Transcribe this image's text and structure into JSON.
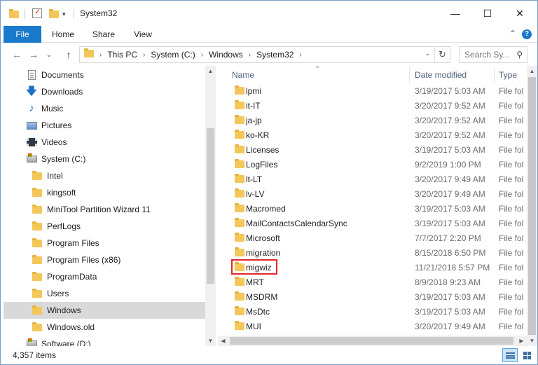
{
  "window": {
    "title": "System32",
    "minimize_glyph": "—",
    "maximize_glyph": "☐",
    "close_glyph": "✕"
  },
  "ribbon": {
    "tabs": [
      "File",
      "Home",
      "Share",
      "View"
    ],
    "help_glyph": "?",
    "collapse_glyph": "⌃"
  },
  "nav": {
    "back_glyph": "←",
    "forward_glyph": "→",
    "recent_glyph": "⌄",
    "up_glyph": "↑"
  },
  "address": {
    "crumbs": [
      "This PC",
      "System (C:)",
      "Windows",
      "System32"
    ],
    "separator": "›",
    "dropdown_glyph": "⌄",
    "refresh_glyph": "↻"
  },
  "search": {
    "placeholder": "Search Sy...",
    "icon_glyph": "⚲"
  },
  "tree": {
    "items": [
      {
        "label": "Documents",
        "icon": "documents-icon"
      },
      {
        "label": "Downloads",
        "icon": "downloads-icon"
      },
      {
        "label": "Music",
        "icon": "music-icon"
      },
      {
        "label": "Pictures",
        "icon": "pictures-icon"
      },
      {
        "label": "Videos",
        "icon": "videos-icon"
      },
      {
        "label": "System (C:)",
        "icon": "drive-icon"
      },
      {
        "label": "Intel",
        "icon": "folder-icon"
      },
      {
        "label": "kingsoft",
        "icon": "folder-icon"
      },
      {
        "label": "MiniTool Partition Wizard 11",
        "icon": "folder-icon"
      },
      {
        "label": "PerfLogs",
        "icon": "folder-icon"
      },
      {
        "label": "Program Files",
        "icon": "folder-icon"
      },
      {
        "label": "Program Files (x86)",
        "icon": "folder-icon"
      },
      {
        "label": "ProgramData",
        "icon": "folder-icon"
      },
      {
        "label": "Users",
        "icon": "folder-icon"
      },
      {
        "label": "Windows",
        "icon": "folder-icon",
        "selected": true
      },
      {
        "label": "Windows.old",
        "icon": "folder-icon"
      },
      {
        "label": "Software (D:)",
        "icon": "drive-icon"
      }
    ]
  },
  "files": {
    "columns": {
      "name": "Name",
      "date": "Date modified",
      "type": "Type"
    },
    "sort_glyph": "^",
    "rows": [
      {
        "name": "lpmi",
        "date": "3/19/2017 5:03 AM",
        "type": "File fol"
      },
      {
        "name": "it-IT",
        "date": "3/20/2017 9:52 AM",
        "type": "File fol"
      },
      {
        "name": "ja-jp",
        "date": "3/20/2017 9:52 AM",
        "type": "File fol"
      },
      {
        "name": "ko-KR",
        "date": "3/20/2017 9:52 AM",
        "type": "File fol"
      },
      {
        "name": "Licenses",
        "date": "3/19/2017 5:03 AM",
        "type": "File fol"
      },
      {
        "name": "LogFiles",
        "date": "9/2/2019 1:00 PM",
        "type": "File fol"
      },
      {
        "name": "lt-LT",
        "date": "3/20/2017 9:49 AM",
        "type": "File fol"
      },
      {
        "name": "lv-LV",
        "date": "3/20/2017 9:49 AM",
        "type": "File fol"
      },
      {
        "name": "Macromed",
        "date": "3/19/2017 5:03 AM",
        "type": "File fol"
      },
      {
        "name": "MailContactsCalendarSync",
        "date": "3/19/2017 5:03 AM",
        "type": "File fol"
      },
      {
        "name": "Microsoft",
        "date": "7/7/2017 2:20 PM",
        "type": "File fol"
      },
      {
        "name": "migration",
        "date": "8/15/2018 6:50 PM",
        "type": "File fol"
      },
      {
        "name": "migwiz",
        "date": "11/21/2018 5:57 PM",
        "type": "File fol",
        "highlighted": true
      },
      {
        "name": "MRT",
        "date": "8/9/2018 9:23 AM",
        "type": "File fol"
      },
      {
        "name": "MSDRM",
        "date": "3/19/2017 5:03 AM",
        "type": "File fol"
      },
      {
        "name": "MsDtc",
        "date": "3/19/2017 5:03 AM",
        "type": "File fol"
      },
      {
        "name": "MUI",
        "date": "3/20/2017 9:49 AM",
        "type": "File fol"
      }
    ]
  },
  "status": {
    "item_count": "4,357 items"
  },
  "scroll_glyphs": {
    "up": "▲",
    "down": "▼",
    "left": "◀",
    "right": "▶"
  },
  "colors": {
    "accent": "#1979ca",
    "folder": "#f3c75a",
    "highlight_box": "#e0282a",
    "selection": "#d9d9d9"
  }
}
